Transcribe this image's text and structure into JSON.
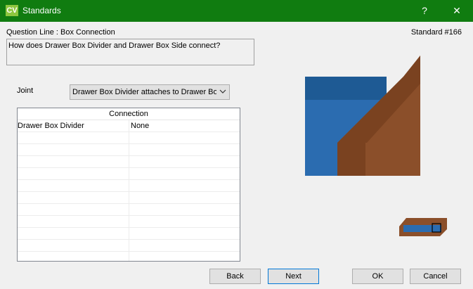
{
  "window": {
    "title": "Standards",
    "icon_text": "CV",
    "help_glyph": "?",
    "close_glyph": "✕"
  },
  "question": {
    "line_label": "Question Line : Box Connection",
    "standard_number": "Standard #166",
    "text": "How does Drawer Box Divider and Drawer Box Side connect?"
  },
  "joint": {
    "label": "Joint",
    "selected": "Drawer Box Divider attaches to Drawer Box Side"
  },
  "connection_table": {
    "header": "Connection",
    "rows": [
      {
        "part": "Drawer Box Divider",
        "value": "None"
      }
    ]
  },
  "buttons": {
    "back": "Back",
    "next": "Next",
    "ok": "OK",
    "cancel": "Cancel"
  },
  "colors": {
    "titlebar": "#107c10",
    "divider_blue": "#2b6cb0",
    "side_brown": "#8b4f2a"
  }
}
